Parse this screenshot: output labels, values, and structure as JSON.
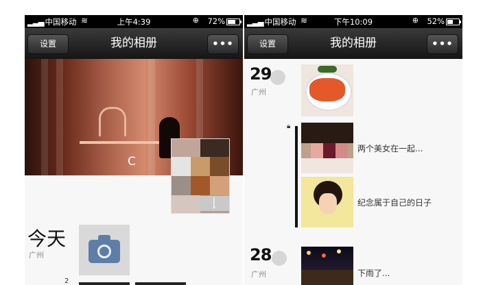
{
  "left": {
    "status": {
      "carrier": "中国移动",
      "time": "上午4:39",
      "battery": "72%",
      "battery_fraction": 0.72
    },
    "nav": {
      "back_label": "设置",
      "title": "我的相册",
      "more_label": "•••"
    },
    "cover_text": "C",
    "nickname": "│̣",
    "today_label": "今天",
    "today_location": "广州",
    "small_text": "2"
  },
  "right": {
    "status": {
      "carrier": "中国移动",
      "time": "下午10:09",
      "battery": "52%",
      "battery_fraction": 0.52
    },
    "nav": {
      "back_label": "设置",
      "title": "我的相册",
      "more_label": "•••"
    },
    "entries": [
      {
        "date": "29",
        "location": "广州",
        "caption": ""
      },
      {
        "date": "",
        "location": "",
        "caption": "两个美女在一起..."
      },
      {
        "date": "",
        "location": "",
        "caption": "纪念属于自己的日子"
      },
      {
        "date": "28",
        "location": "广州",
        "caption": "下雨了..."
      }
    ]
  },
  "colors": {
    "navbar": "#222222",
    "camera_icon": "#5e7ea8",
    "background": "#f7f7f7"
  },
  "icons": [
    "signal-bars-icon",
    "wifi-icon",
    "orientation-lock-icon",
    "battery-icon",
    "camera-icon",
    "lock-icon"
  ]
}
